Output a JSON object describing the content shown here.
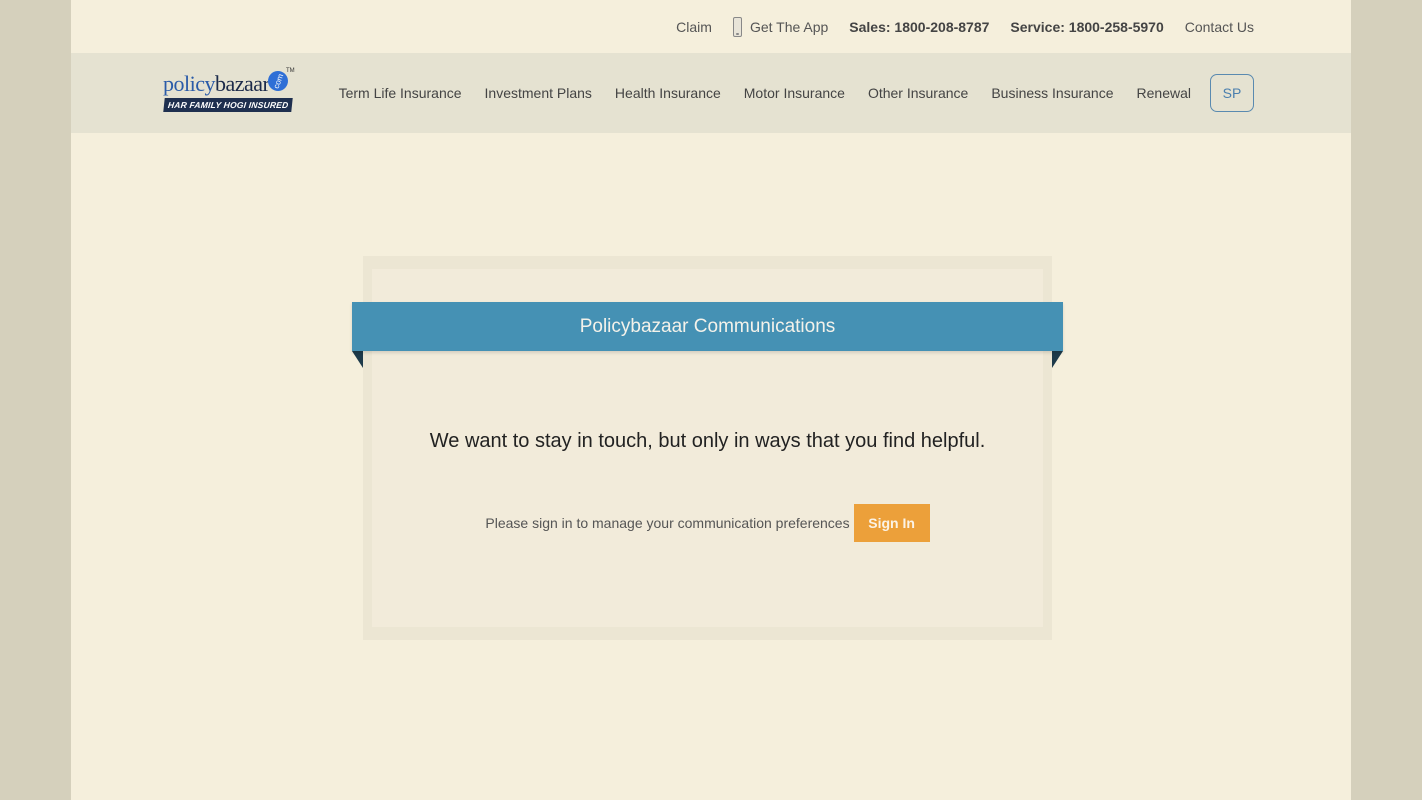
{
  "topbar": {
    "claim": "Claim",
    "get_app": "Get The App",
    "sales": "Sales: 1800-208-8787",
    "service": "Service: 1800-258-5970",
    "contact": "Contact Us"
  },
  "logo": {
    "word_part1": "policy",
    "word_part2": "bazaar",
    "dot_text": "com",
    "tm": "TM",
    "tagline": "HAR FAMILY HOGI INSURED"
  },
  "nav": {
    "items": [
      {
        "label": "Term Life Insurance"
      },
      {
        "label": "Investment Plans"
      },
      {
        "label": "Health Insurance"
      },
      {
        "label": "Motor Insurance"
      },
      {
        "label": "Other Insurance"
      },
      {
        "label": "Business Insurance"
      },
      {
        "label": "Renewal"
      }
    ],
    "user_initials": "SP"
  },
  "card": {
    "title": "Policybazaar Communications",
    "headline": "We want to stay in touch, but only in ways that you find helpful.",
    "prompt": "Please sign in to manage your communication preferences",
    "signin_label": "Sign In"
  },
  "colors": {
    "page_bg": "#f5efdc",
    "ribbon": "#4591b4",
    "signin_button": "#eca03a"
  }
}
